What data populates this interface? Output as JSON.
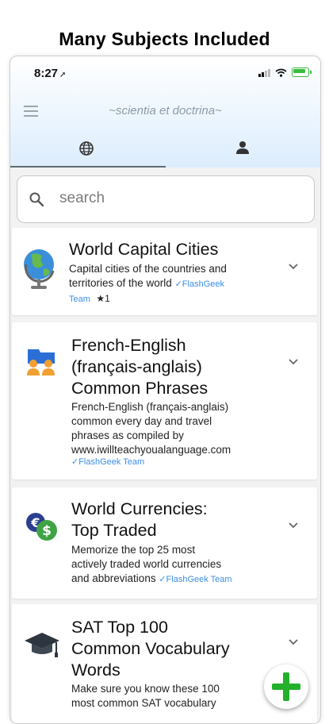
{
  "promo": {
    "title": "Many Subjects Included"
  },
  "status_bar": {
    "time": "8:27"
  },
  "header": {
    "title": "~scientia et doctrina~"
  },
  "tabs": [
    {
      "icon": "globe-icon",
      "selected": true
    },
    {
      "icon": "person-icon",
      "selected": false
    }
  ],
  "search": {
    "placeholder": "search"
  },
  "cards": [
    {
      "icon": "globe-icon",
      "title_lines": [
        "World Capital Cities"
      ],
      "desc_lines": [
        "Capital cities of the countries and",
        "territories of the world"
      ],
      "verified_inline": "✓FlashGeek",
      "verified_next": "Team",
      "stars": "★1"
    },
    {
      "icon": "people-flag-icon",
      "title_lines": [
        "French-English",
        "(français-anglais)",
        "Common Phrases"
      ],
      "desc_lines": [
        "French-English (français-anglais)",
        "common every day and travel",
        "phrases as compiled by",
        "www.iwillteachyoualanguage.com"
      ],
      "verified": "✓FlashGeek Team"
    },
    {
      "icon": "currency-icon",
      "title_lines": [
        "World Currencies:",
        "Top Traded"
      ],
      "desc_lines": [
        "Memorize the top 25 most",
        "actively traded world currencies",
        "and abbreviations"
      ],
      "verified": "✓FlashGeek Team"
    },
    {
      "icon": "graduation-cap-icon",
      "title_lines": [
        "SAT Top 100",
        "Common Vocabulary",
        "Words"
      ],
      "desc_lines": [
        "Make sure you know these 100",
        "most common SAT vocabulary"
      ]
    }
  ],
  "fab": {
    "label": "add-deck"
  },
  "colors": {
    "accent_green": "#23b02b",
    "verified_blue": "#3a8fe6",
    "header_gradient_end": "#dcedfd"
  }
}
